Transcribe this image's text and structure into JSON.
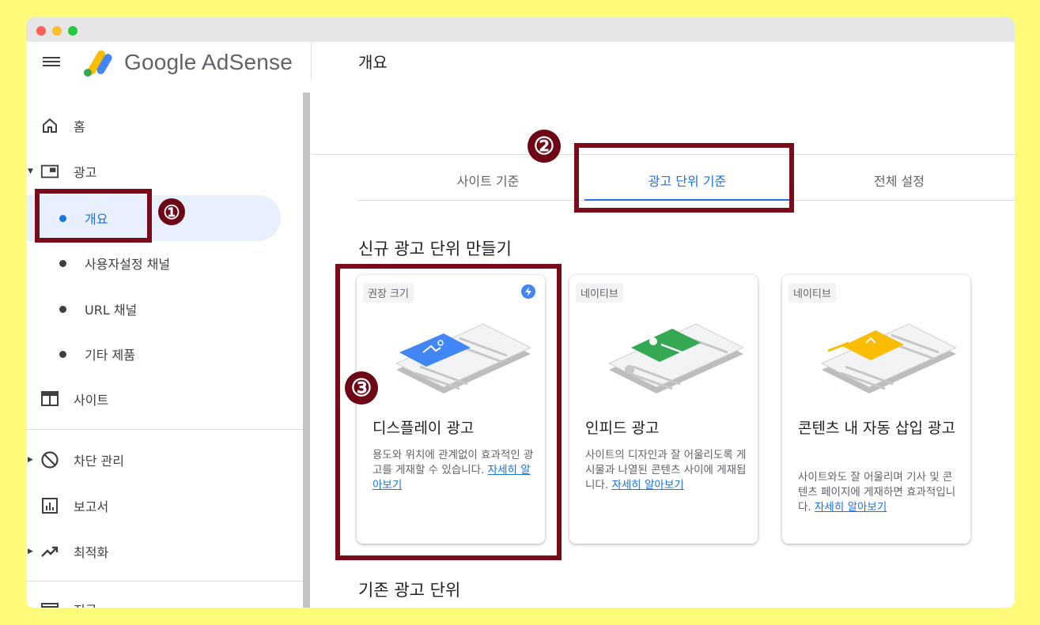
{
  "app": {
    "brand": "Google AdSense",
    "page_title": "개요"
  },
  "sidebar": {
    "items": [
      {
        "label": "홈",
        "icon": "home-icon"
      },
      {
        "label": "광고",
        "icon": "ad-icon"
      },
      {
        "label": "개요",
        "active": true
      },
      {
        "label": "사용자설정 채널"
      },
      {
        "label": "URL 채널"
      },
      {
        "label": "기타 제품"
      },
      {
        "label": "사이트",
        "icon": "site-icon"
      },
      {
        "label": "차단 관리",
        "icon": "block-icon"
      },
      {
        "label": "보고서",
        "icon": "report-icon"
      },
      {
        "label": "최적화",
        "icon": "optimize-icon"
      },
      {
        "label": "지급",
        "icon": "payment-icon"
      }
    ]
  },
  "tabs": [
    {
      "label": "사이트 기준"
    },
    {
      "label": "광고 단위 기준",
      "active": true
    },
    {
      "label": "전체 설정"
    }
  ],
  "new_section_title": "신규 광고 단위 만들기",
  "existing_section_title": "기존 광고 단위",
  "cards": [
    {
      "chip": "권장 크기",
      "title": "디스플레이 광고",
      "description": "용도와 위치에 관계없이 효과적인 광고를 게재할 수 있습니다.",
      "link": "자세히 알아보기",
      "accent": "#4285f4"
    },
    {
      "chip": "네이티브",
      "title": "인피드 광고",
      "description": "사이트의 디자인과 잘 어울리도록 게시물과 나열된 콘텐츠 사이에 게재됩니다.",
      "link": "자세히 알아보기",
      "accent": "#34a853"
    },
    {
      "chip": "네이티브",
      "title": "콘텐츠 내 자동 삽입 광고",
      "description": "사이트와도 잘 어울리며 기사 및 콘텐츠 페이지에 게재하면 효과적입니다.",
      "link": "자세히 알아보기",
      "accent": "#fbbc04"
    }
  ],
  "annotations": [
    "①",
    "②",
    "③"
  ],
  "colors": {
    "highlight": "#7b0b1a",
    "accent": "#1a73e8",
    "background": "#fffb7a"
  }
}
